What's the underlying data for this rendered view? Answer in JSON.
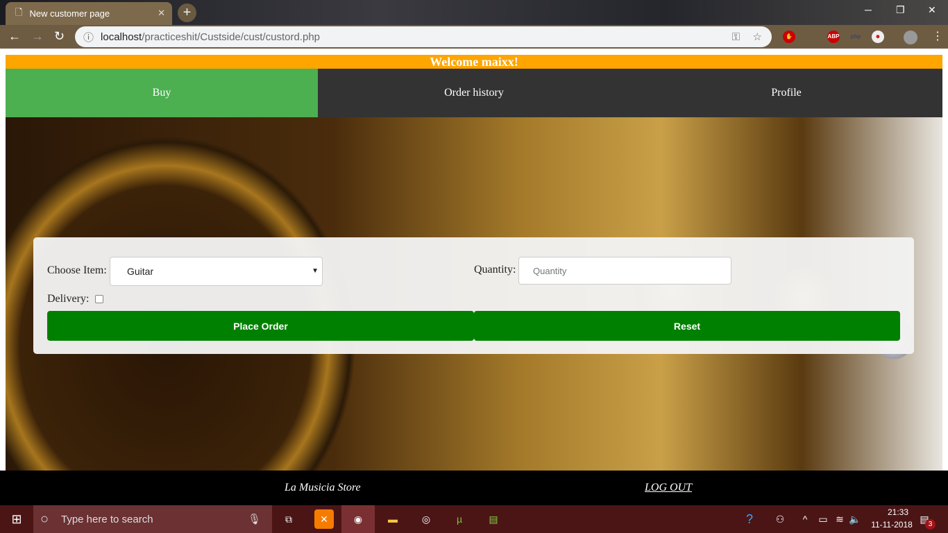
{
  "browser": {
    "tab_title": "New customer page",
    "url_host": "localhost",
    "url_path": "/practiceshit/Custside/cust/custord.php"
  },
  "page": {
    "welcome": "Welcome maixx!",
    "menu": [
      {
        "label": "Buy"
      },
      {
        "label": "Order history"
      },
      {
        "label": "Profile"
      }
    ],
    "form": {
      "choose_item_label": "Choose Item:",
      "item_value": "Guitar",
      "quantity_label": "Quantity:",
      "quantity_placeholder": "Quantity",
      "delivery_label": "Delivery:",
      "delivery_checked": false,
      "place_order": "Place Order",
      "reset": "Reset"
    },
    "footer": {
      "store": "La Musicia Store",
      "logout": "LOG OUT"
    }
  },
  "taskbar": {
    "search_placeholder": "Type here to search",
    "time": "21:33",
    "date": "11-11-2018",
    "notifications": "3"
  },
  "colors": {
    "welcome": "#FFA500",
    "active_menu": "#4CAF50",
    "menu": "#333333",
    "button": "#008000"
  }
}
